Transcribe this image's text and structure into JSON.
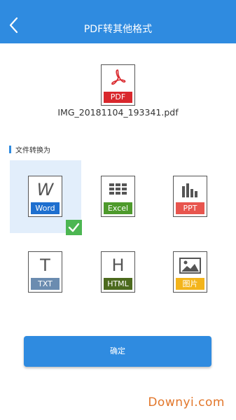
{
  "header": {
    "title": "PDF转其他格式",
    "back_icon": "chevron-left-icon",
    "color": "#2f8be0"
  },
  "source_file": {
    "icon_label": "PDF",
    "name": "IMG_20181104_193341.pdf",
    "icon": "pdf-icon",
    "color": "#d9272c"
  },
  "section": {
    "title": "文件转换为"
  },
  "formats": [
    {
      "label": "Word",
      "glyph": "W",
      "color": "#1e6fcf",
      "selected": true
    },
    {
      "label": "Excel",
      "glyph": "grid",
      "color": "#4e9a2c",
      "selected": false
    },
    {
      "label": "PPT",
      "glyph": "bars",
      "color": "#e8554e",
      "selected": false
    },
    {
      "label": "TXT",
      "glyph": "T",
      "color": "#6b8cb0",
      "selected": false
    },
    {
      "label": "HTML",
      "glyph": "H",
      "color": "#4c6a1e",
      "selected": false
    },
    {
      "label": "图片",
      "glyph": "image",
      "color": "#f3b41b",
      "selected": false
    }
  ],
  "confirm_button": {
    "label": "确定"
  },
  "watermark": {
    "text": "Downyi.com"
  }
}
